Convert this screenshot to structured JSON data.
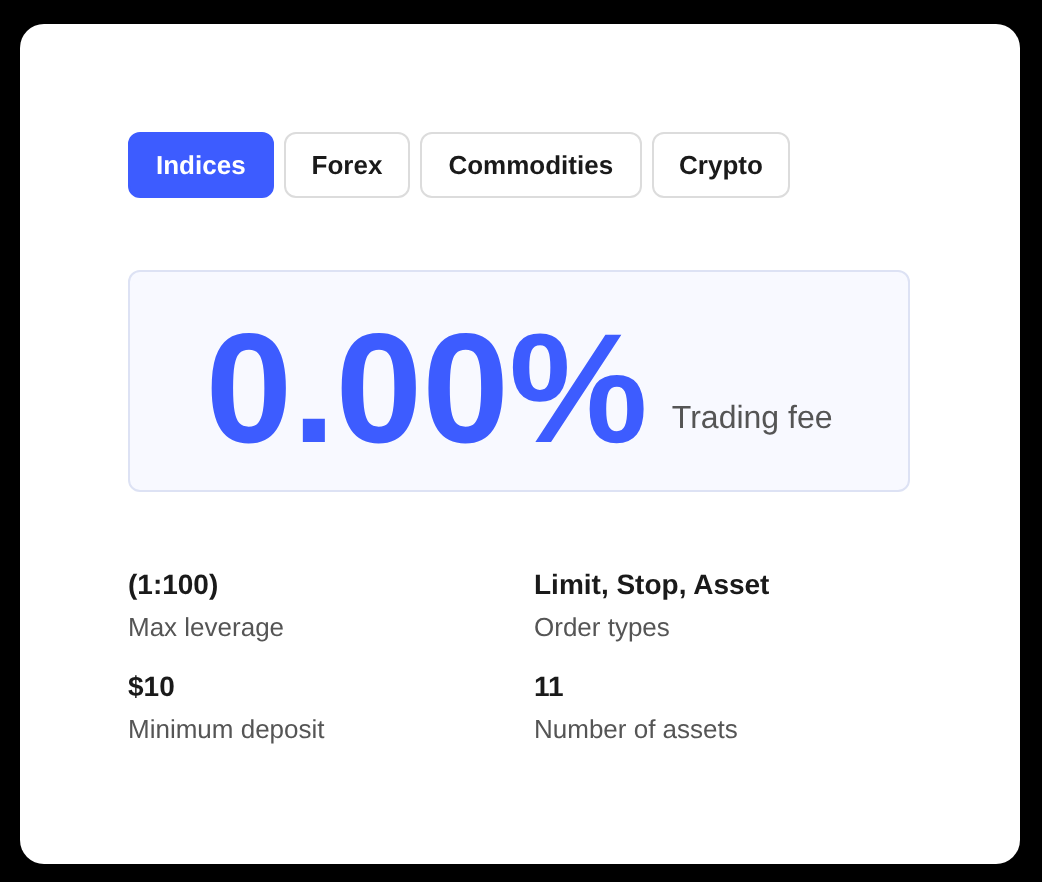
{
  "tabs": [
    {
      "label": "Indices",
      "selected": true
    },
    {
      "label": "Forex",
      "selected": false
    },
    {
      "label": "Commodities",
      "selected": false
    },
    {
      "label": "Crypto",
      "selected": false
    }
  ],
  "fee": {
    "value": "0.00%",
    "label": "Trading fee"
  },
  "stats": [
    {
      "value": "(1:100)",
      "label": "Max leverage"
    },
    {
      "value": "Limit, Stop, Asset",
      "label": "Order types"
    },
    {
      "value": "$10",
      "label": "Minimum deposit"
    },
    {
      "value": "11",
      "label": "Number of assets"
    }
  ]
}
